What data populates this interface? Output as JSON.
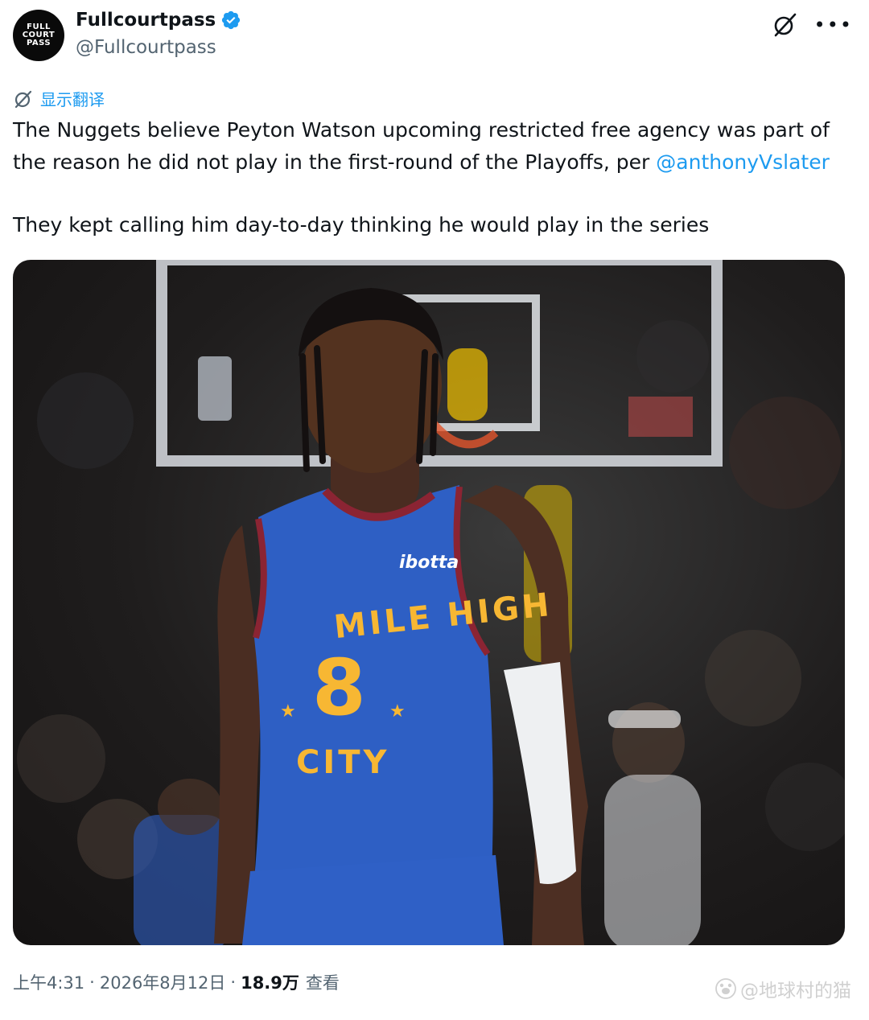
{
  "account": {
    "avatar_text": [
      "FULL",
      "COURT",
      "PASS"
    ],
    "display_name": "Fullcourtpass",
    "handle": "@Fullcourtpass",
    "verified": true
  },
  "translate": {
    "label": "显示翻译"
  },
  "tweet": {
    "text_line1_before": "The Nuggets believe Peyton Watson upcoming restricted free agency was part of the reason he did not play in the first-round of the Playoffs, per ",
    "mention": "@anthonyVslater",
    "paragraph2": "They kept calling him day-to-day thinking he would play in the series"
  },
  "photo": {
    "jersey_text_top": "MILE HIGH",
    "jersey_number": "8",
    "jersey_text_bottom": "CITY",
    "sponsor": "ibotta"
  },
  "meta": {
    "time": "上午4:31",
    "date": "2026年8月12日",
    "views_count": "18.9万",
    "views_label": "查看"
  },
  "watermark": {
    "text": "@地球村的猫"
  },
  "colors": {
    "accent": "#1d9bf0",
    "jersey": "#2e5fc4",
    "jersey_gold": "#f7b733",
    "jersey_red": "#8b2433"
  },
  "icons": [
    "verified-badge-icon",
    "grok-icon",
    "more-icon",
    "translate-icon",
    "watermark-paw-icon"
  ]
}
